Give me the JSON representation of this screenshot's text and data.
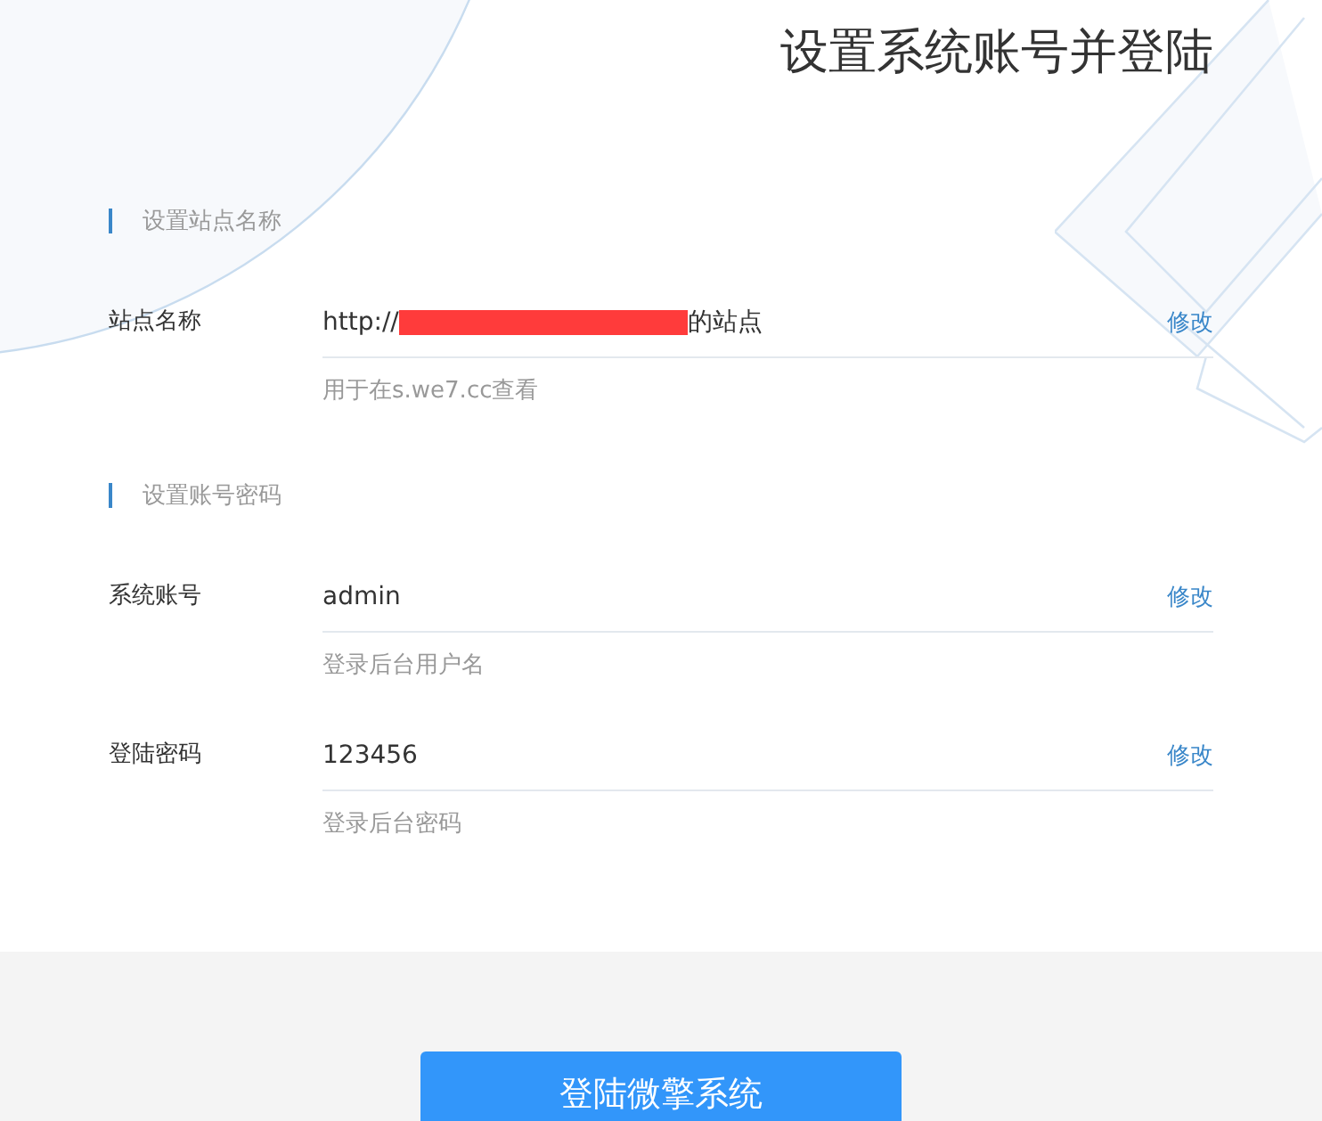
{
  "title": "设置系统账号并登陆",
  "sections": [
    {
      "heading": "设置站点名称",
      "rows": [
        {
          "label": "站点名称",
          "value": [
            {
              "kind": "text",
              "text": "http://"
            },
            {
              "kind": "redacted"
            },
            {
              "kind": "text",
              "text": "的站点"
            }
          ],
          "action": "修改",
          "hint": "用于在s.we7.cc查看"
        }
      ]
    },
    {
      "heading": "设置账号密码",
      "rows": [
        {
          "label": "系统账号",
          "value": [
            {
              "kind": "text",
              "text": "admin"
            }
          ],
          "action": "修改",
          "hint": "登录后台用户名"
        },
        {
          "label": "登陆密码",
          "value": [
            {
              "kind": "text",
              "text": "123456"
            }
          ],
          "action": "修改",
          "hint": "登录后台密码"
        }
      ]
    }
  ],
  "button": "登陆微擎系统"
}
